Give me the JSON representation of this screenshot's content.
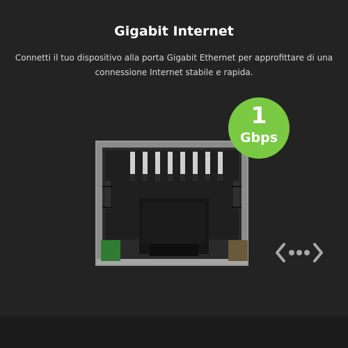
{
  "title": "Gigabit Internet",
  "description": "Connetti il tuo dispositivo alla porta Gigabit Ethernet per approfittare di una connessione Internet stabile e rapida.",
  "badge": {
    "value": "1",
    "unit": "Gbps",
    "color": "#7ac943"
  },
  "colors": {
    "background": "#232323",
    "port_frame": "#9a9a9a",
    "port_inner": "#262626",
    "led_left": "#2e7d32",
    "led_right": "#6b5a3a"
  },
  "icons": {
    "port": "ethernet-port-icon",
    "network": "network-dots-icon"
  }
}
